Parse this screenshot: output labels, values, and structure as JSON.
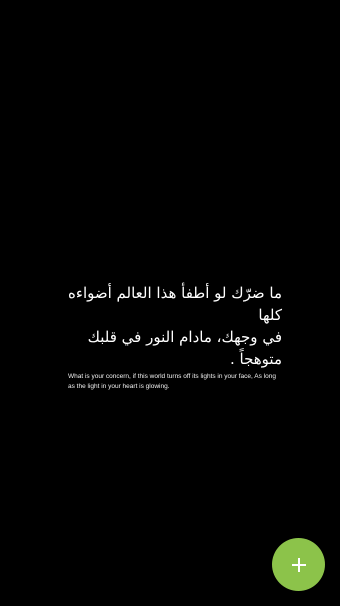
{
  "quote": {
    "arabic_line_1": "ما ضرّك لو أطفأ هذا العالم أضواءه كلها",
    "arabic_line_2": "في وجهك، مادام النور في قلبك متوهجاً .",
    "english": "What is your concern, if this world turns off its lights in your face, As long as the light in your heart is glowing."
  },
  "fab": {
    "icon": "plus-icon",
    "color": "#8cc34a"
  }
}
